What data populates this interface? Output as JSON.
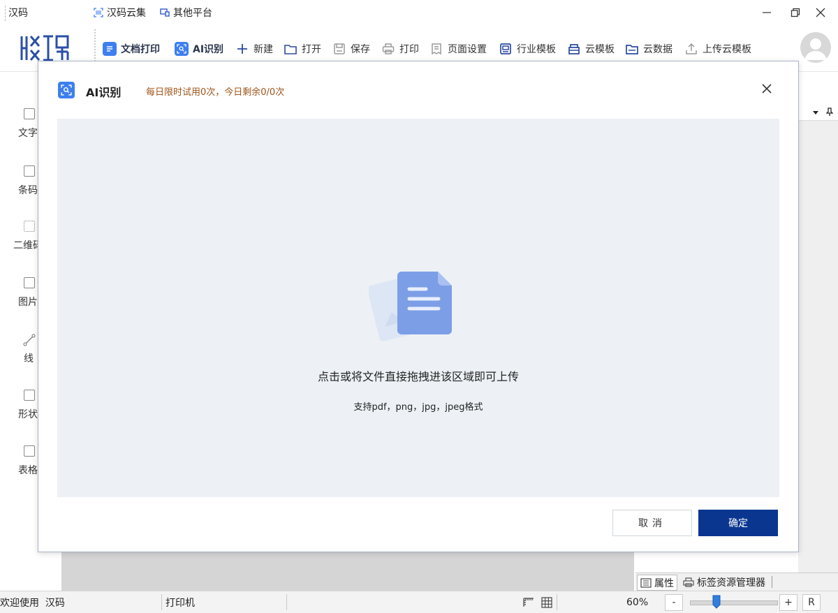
{
  "titlebar": {
    "app_title": "汉码",
    "links": [
      "汉码云集",
      "其他平台"
    ]
  },
  "toolbar": {
    "items": [
      {
        "label": "文档打印",
        "icon": "document-print-icon"
      },
      {
        "label": "AI识别",
        "icon": "ai-scan-icon"
      },
      {
        "label": "新建",
        "icon": "plus-icon"
      },
      {
        "label": "打开",
        "icon": "folder-open-icon"
      },
      {
        "label": "保存",
        "icon": "save-icon"
      },
      {
        "label": "打印",
        "icon": "printer-icon"
      },
      {
        "label": "页面设置",
        "icon": "page-setup-icon"
      },
      {
        "label": "行业模板",
        "icon": "industry-template-icon"
      },
      {
        "label": "云模板",
        "icon": "cloud-template-icon"
      },
      {
        "label": "云数据",
        "icon": "cloud-data-icon"
      },
      {
        "label": "上传云模板",
        "icon": "upload-icon"
      }
    ]
  },
  "sidebar": {
    "items": [
      {
        "label": "文字"
      },
      {
        "label": "条码"
      },
      {
        "label": "二维码"
      },
      {
        "label": "图片"
      },
      {
        "label": "线"
      },
      {
        "label": "形状"
      },
      {
        "label": "表格"
      }
    ]
  },
  "modal": {
    "title": "AI识别",
    "quota": "每日限时试用0次，今日剩余0/0次",
    "dropzone_main": "点击或将文件直接拖拽进该区域即可上传",
    "dropzone_sub": "支持pdf，png，jpg，jpeg格式",
    "cancel_label": "取消",
    "ok_label": "确定"
  },
  "bottom_tabs": [
    "属性",
    "标签资源管理器"
  ],
  "statusbar": {
    "welcome": "欢迎使用  汉码",
    "printer": "打印机",
    "zoom": "60%",
    "zoom_level": 0.3,
    "minus": "-",
    "plus": "+",
    "reset": "R"
  },
  "colors": {
    "accent": "#3d7ff0",
    "primary_button": "#0b3690",
    "quota_text": "#a0541a",
    "dropzone_bg": "#edf1f5"
  }
}
